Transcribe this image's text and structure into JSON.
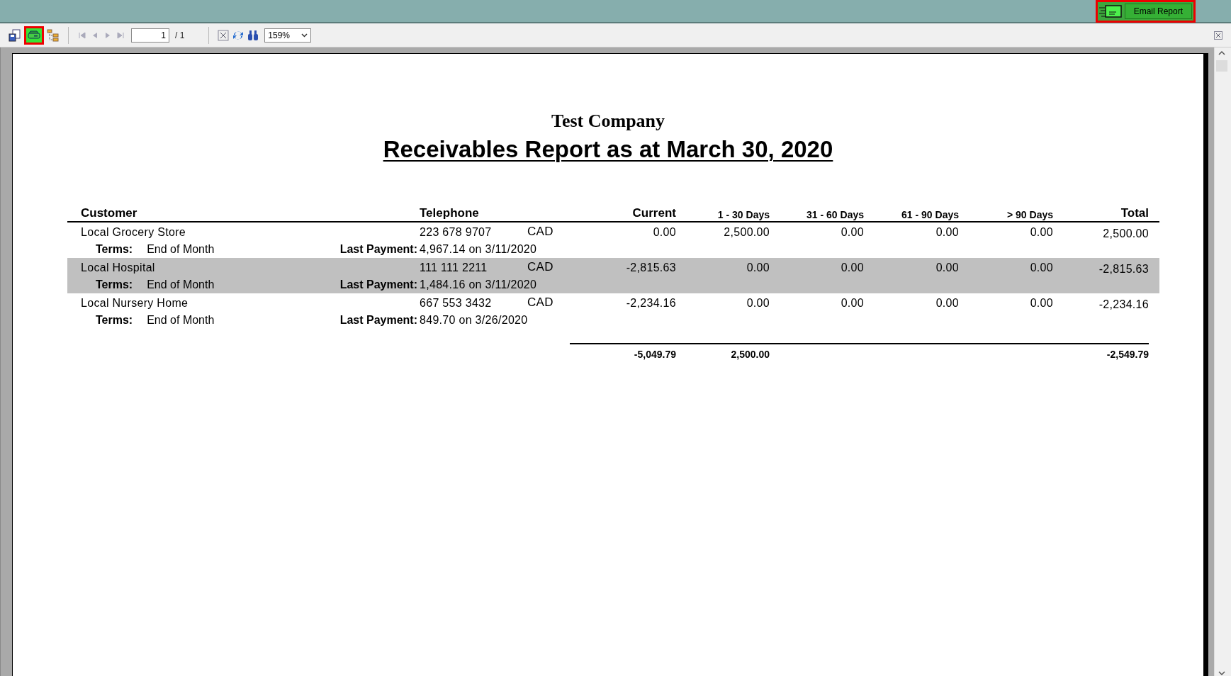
{
  "header": {
    "email_button": {
      "label": "Email Report"
    }
  },
  "toolbar": {
    "print_selected": true,
    "page_field": {
      "value": "1"
    },
    "page_count": "/ 1",
    "zoom": {
      "value": "159%"
    }
  },
  "report": {
    "company": "Test Company",
    "title": "Receivables Report as at March 30, 2020",
    "columns": [
      "Customer",
      "Telephone",
      "Current",
      "1 - 30 Days",
      "31 - 60 Days",
      "61 - 90 Days",
      "> 90 Days",
      "Total"
    ],
    "rows": [
      {
        "customer": "Local Grocery Store",
        "telephone": "223 678 9707",
        "currency": "CAD",
        "amounts": [
          "0.00",
          "2,500.00",
          "0.00",
          "0.00",
          "0.00"
        ],
        "total": "2,500.00",
        "terms_label": "Terms:",
        "terms": "End of Month",
        "last_payment_label": "Last Payment:",
        "last_payment": "4,967.14 on 3/11/2020",
        "shaded": false
      },
      {
        "customer": "Local Hospital",
        "telephone": "111 111 2211",
        "currency": "CAD",
        "amounts": [
          "-2,815.63",
          "0.00",
          "0.00",
          "0.00",
          "0.00"
        ],
        "total": "-2,815.63",
        "terms_label": "Terms:",
        "terms": "End of Month",
        "last_payment_label": "Last Payment:",
        "last_payment": "1,484.16 on 3/11/2020",
        "shaded": true
      },
      {
        "customer": "Local Nursery Home",
        "telephone": "667 553 3432",
        "currency": "CAD",
        "amounts": [
          "-2,234.16",
          "0.00",
          "0.00",
          "0.00",
          "0.00"
        ],
        "total": "-2,234.16",
        "terms_label": "Terms:",
        "terms": "End of Month",
        "last_payment_label": "Last Payment:",
        "last_payment": "849.70 on 3/26/2020",
        "shaded": false
      }
    ],
    "totals": {
      "current": "-5,049.79",
      "days_1_30": "2,500.00",
      "total": "-2,549.79"
    }
  }
}
